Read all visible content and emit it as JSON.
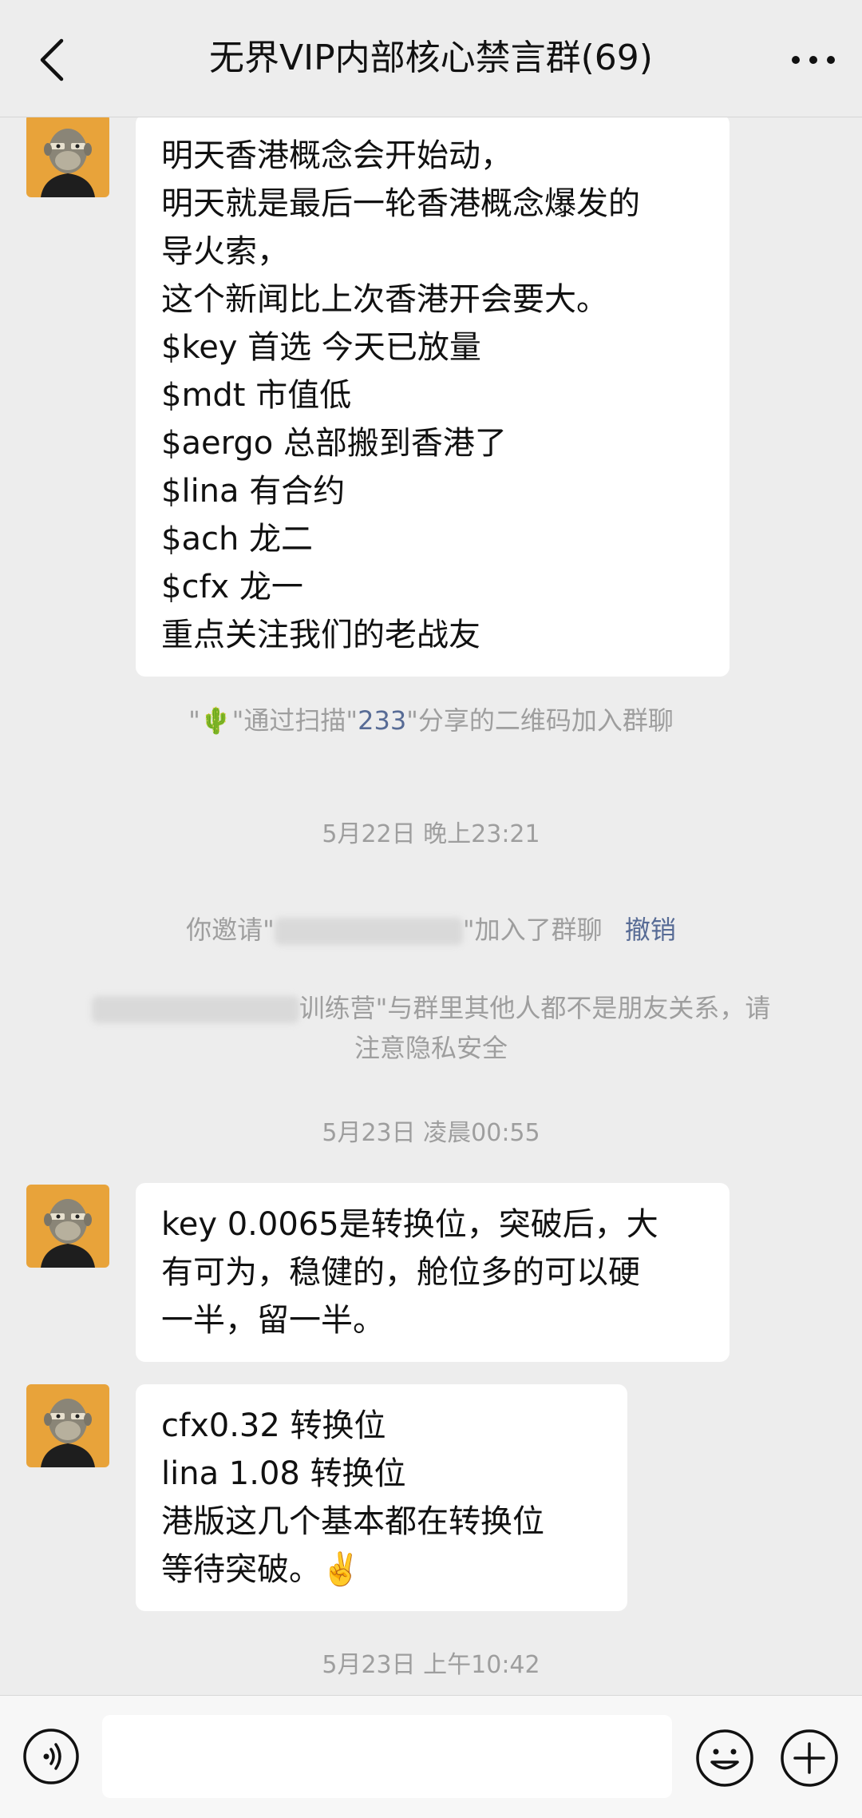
{
  "header": {
    "title": "无界VIP内部核心禁言群(69)",
    "back_icon": "chevron-left-icon",
    "more_icon": "more-dots-icon"
  },
  "messages": [
    {
      "lines": [
        "明天香港概念会开始动，",
        "明天就是最后一轮香港概念爆发的",
        "导火索，",
        "这个新闻比上次香港开会要大。",
        "$key 首选 今天已放量",
        "$mdt 市值低",
        "$aergo 总部搬到香港了",
        "$lina 有合约",
        "$ach 龙二",
        "$cfx 龙一",
        "重点关注我们的老战友"
      ]
    },
    {
      "lines": [
        "key 0.0065是转换位，突破后，大",
        "有可为，稳健的，舱位多的可以硬",
        "一半，留一半。"
      ]
    },
    {
      "lines": [
        "cfx0.32  转换位",
        "lina 1.08  转换位",
        "港版这几个基本都在转换位",
        "等待突破。✌️"
      ]
    }
  ],
  "system": {
    "join_prefix": "\"🌵\"通过扫描\"",
    "join_name": "233",
    "join_suffix": "\"分享的二维码加入群聊",
    "invite_prefix": "你邀请\"",
    "invite_suffix": "\"加入了群聊",
    "invite_revoke": "撤销",
    "privacy_line1_tail": "训练营\"与群里其他人都不是朋友关系，请",
    "privacy_line2": "注意隐私安全"
  },
  "timestamps": [
    "5月22日 晚上23:21",
    "5月23日 凌晨00:55",
    "5月23日 上午10:42"
  ],
  "input_bar": {
    "voice_icon": "voice-icon",
    "emoji_icon": "emoji-icon",
    "plus_icon": "plus-icon"
  },
  "colors": {
    "background": "#ededed",
    "bubble": "#ffffff",
    "link": "#576b95",
    "system_text": "#9e9e9e",
    "avatar_bg": "#e8a33a"
  }
}
